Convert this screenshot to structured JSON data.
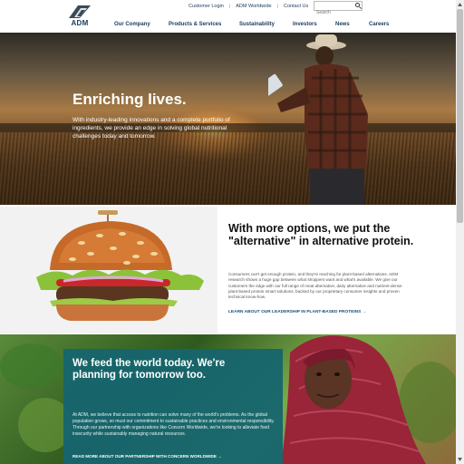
{
  "header": {
    "logo_text": "ADM",
    "utility_links": [
      "Customer Login",
      "ADM Worldwide",
      "Contact Us"
    ],
    "search_placeholder": "Search",
    "nav": [
      "Our Company",
      "Products & Services",
      "Sustainability",
      "Investors",
      "News",
      "Careers"
    ]
  },
  "hero": {
    "title": "Enriching lives.",
    "text": "With industry-leading innovations and a complete portfolio of ingredients, we provide an edge in solving global nutritional challenges today and tomorrow."
  },
  "protein": {
    "title": "With more options, we put the \"alternative\" in alternative protein.",
    "text": "Consumers can't get enough protein, and they're reaching for plant-based alternatives. ADM research shows a huge gap between what shoppers want and what's available. We give our customers the edge with our full range of meat alternative, dairy alternative and nutrient-dense plant-based protein smart solutions, backed by our proprietary consumer insights and proven technical know-how.",
    "link": "LEARN ABOUT OUR LEADERSHIP IN PLANT-BASED PROTEINS"
  },
  "feed": {
    "title": "We feed the world today. We're planning for tomorrow too.",
    "text": "At ADM, we believe that access to nutrition can solve many of the world's problems. As the global population grows, so must our commitment to sustainable practices and environmental responsibility. Through our partnership with organizations like Concern Worldwide, we're looking to alleviate food insecurity while sustainably managing natural resources.",
    "link": "READ MORE ABOUT OUR PARTNERSHIP WITH CONCERN WORLDWIDE"
  },
  "colors": {
    "brand_navy": "#1a3a5c",
    "feed_card_teal": "#15656e",
    "link_blue": "#1a4f7a"
  }
}
